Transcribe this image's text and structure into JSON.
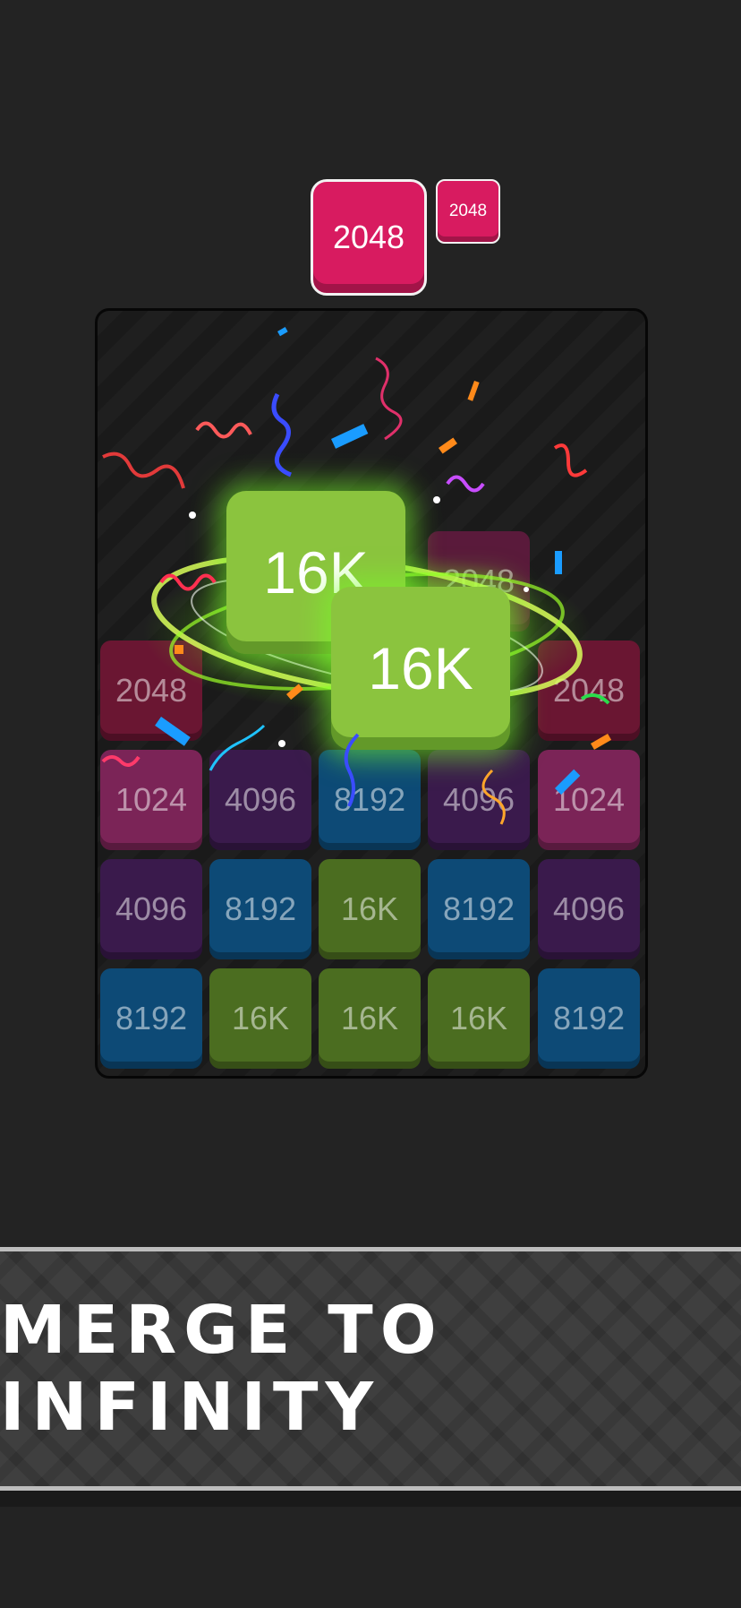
{
  "next_tiles": {
    "current": "2048",
    "upcoming": "2048"
  },
  "board": {
    "rows": [
      [
        "",
        "",
        "",
        "",
        ""
      ],
      [
        "",
        "",
        "",
        "2048",
        ""
      ],
      [
        "2048",
        "",
        "",
        "",
        "2048"
      ],
      [
        "1024",
        "4096",
        "8192",
        "4096",
        "1024"
      ],
      [
        "4096",
        "8192",
        "16K",
        "8192",
        "4096"
      ],
      [
        "8192",
        "16K",
        "16K",
        "16K",
        "8192"
      ]
    ]
  },
  "merge_tiles": [
    "16K",
    "16K"
  ],
  "banner": {
    "text": "MERGE TO INFINITY"
  },
  "colors": {
    "1024": "#7b2457",
    "2048": "#6a1632",
    "4096": "#3a1a4c",
    "8192": "#0d4a76",
    "16K": "#4b6d20",
    "merge": "#8bc43e"
  }
}
